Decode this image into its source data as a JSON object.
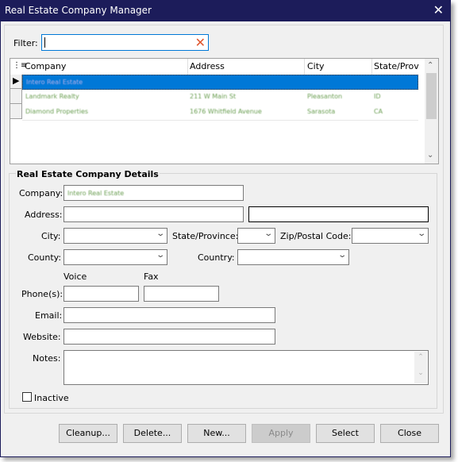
{
  "window": {
    "title": "Real Estate Company Manager",
    "close_icon": "close-icon"
  },
  "filter": {
    "label": "Filter:",
    "value": "",
    "clear_icon": "clear-x-icon"
  },
  "grid": {
    "columns": [
      "Company",
      "Address",
      "City",
      "State/Prov"
    ],
    "rows": [
      {
        "selected": true,
        "company": "Intero Real Estate",
        "address": "",
        "city": "",
        "state": ""
      },
      {
        "selected": false,
        "company": "Landmark Realty",
        "address": "211 W Main St",
        "city": "Pleasanton",
        "state": "ID"
      },
      {
        "selected": false,
        "company": "Diamond Properties",
        "address": "1676 Whitfield Avenue",
        "city": "Sarasota",
        "state": "CA"
      }
    ]
  },
  "details": {
    "group_title": "Real Estate Company Details",
    "company_label": "Company:",
    "company_value": "Intero Real Estate",
    "address_label": "Address:",
    "address1_value": "",
    "address2_value": "",
    "city_label": "City:",
    "city_value": "",
    "state_label": "State/Province:",
    "state_value": "",
    "zip_label": "Zip/Postal Code:",
    "zip_value": "",
    "county_label": "County:",
    "county_value": "",
    "country_label": "Country:",
    "country_value": "",
    "voice_label": "Voice",
    "fax_label": "Fax",
    "phones_label": "Phone(s):",
    "voice_value": "",
    "fax_value": "",
    "email_label": "Email:",
    "email_value": "",
    "website_label": "Website:",
    "website_value": "",
    "notes_label": "Notes:",
    "notes_value": "",
    "inactive_label": "Inactive",
    "inactive_checked": false
  },
  "buttons": {
    "cleanup": "Cleanup...",
    "delete": "Delete...",
    "new": "New...",
    "apply": "Apply",
    "select": "Select",
    "close": "Close"
  }
}
